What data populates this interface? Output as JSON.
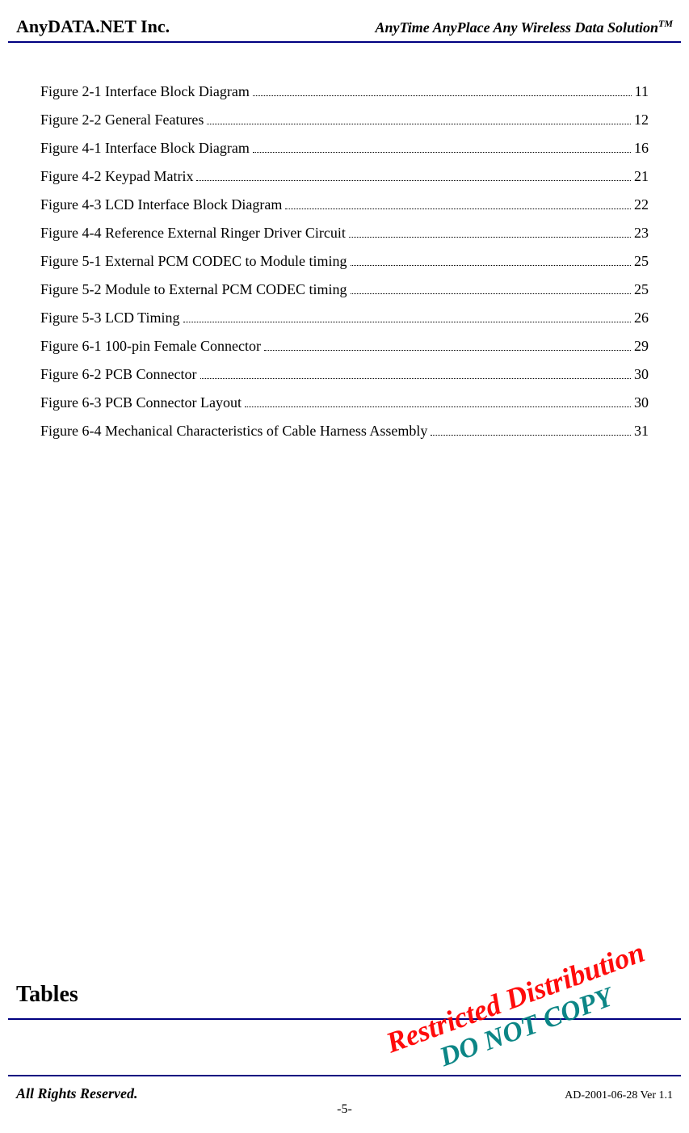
{
  "header": {
    "company": "AnyDATA.NET Inc.",
    "tagline": "AnyTime AnyPlace Any Wireless Data Solution",
    "tagline_sup": "TM"
  },
  "toc": [
    {
      "label": "Figure 2-1 Interface Block Diagram",
      "page": "11"
    },
    {
      "label": "Figure 2-2 General Features",
      "page": "12"
    },
    {
      "label": "Figure 4-1 Interface Block Diagram",
      "page": "16"
    },
    {
      "label": "Figure 4-2 Keypad Matrix",
      "page": "21"
    },
    {
      "label": "Figure 4-3 LCD Interface Block Diagram",
      "page": "22"
    },
    {
      "label": "Figure 4-4 Reference External Ringer Driver Circuit",
      "page": "23"
    },
    {
      "label": "Figure 5-1 External PCM CODEC to Module timing",
      "page": "25"
    },
    {
      "label": "Figure 5-2 Module to External PCM CODEC timing",
      "page": "25"
    },
    {
      "label": "Figure 5-3 LCD Timing",
      "page": "26"
    },
    {
      "label": "Figure 6-1 100-pin Female Connector",
      "page": "29"
    },
    {
      "label": "Figure 6-2 PCB Connector",
      "page": "30"
    },
    {
      "label": "Figure 6-3 PCB Connector Layout",
      "page": "30"
    },
    {
      "label": "Figure 6-4 Mechanical Characteristics of Cable Harness Assembly",
      "page": "31"
    }
  ],
  "section_title": "Tables",
  "watermark": {
    "line1": "Restricted Distribution",
    "line2": "DO NOT COPY"
  },
  "footer": {
    "left": "All Rights Reserved.",
    "right": "AD-2001-06-28 Ver 1.1",
    "page_number": "-5-"
  }
}
